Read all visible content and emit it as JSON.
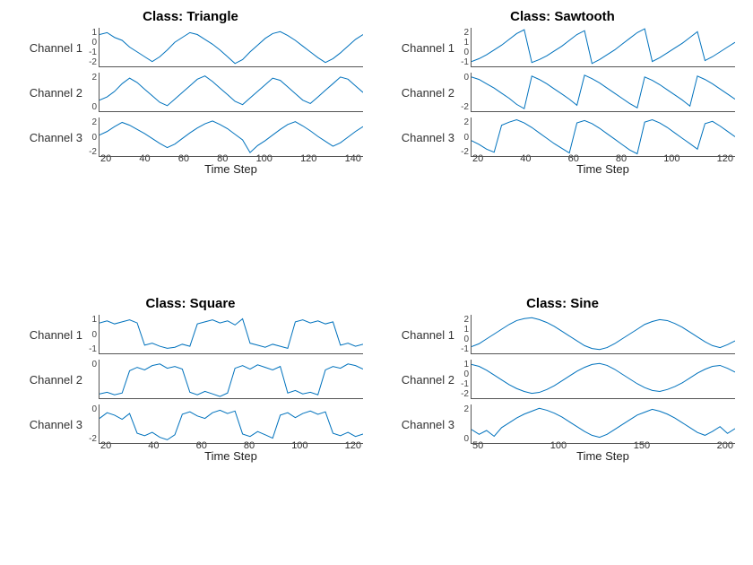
{
  "chart_data": [
    {
      "title": "Class: Triangle",
      "xlabel": "Time Step",
      "xticks": [
        "20",
        "40",
        "60",
        "80",
        "100",
        "120",
        "140"
      ],
      "xmax": 140,
      "channels": [
        {
          "label": "Channel 1",
          "yticks": [
            "1",
            "0",
            "-1",
            "-2"
          ],
          "ymin": -2.5,
          "ymax": 1.5,
          "data": [
            0.8,
            1.0,
            0.5,
            0.2,
            -0.5,
            -1.0,
            -1.5,
            -2.0,
            -1.5,
            -0.8,
            0.0,
            0.5,
            1.0,
            0.8,
            0.3,
            -0.2,
            -0.8,
            -1.5,
            -2.2,
            -1.8,
            -1.0,
            -0.3,
            0.4,
            0.9,
            1.1,
            0.7,
            0.2,
            -0.4,
            -1.0,
            -1.6,
            -2.1,
            -1.7,
            -1.1,
            -0.4,
            0.3,
            0.8
          ]
        },
        {
          "label": "Channel 2",
          "yticks": [
            "2",
            "0"
          ],
          "ymin": -1.0,
          "ymax": 2.5,
          "data": [
            0.0,
            0.3,
            0.8,
            1.5,
            2.0,
            1.6,
            1.0,
            0.4,
            -0.2,
            -0.5,
            0.1,
            0.7,
            1.3,
            1.9,
            2.2,
            1.7,
            1.1,
            0.5,
            -0.1,
            -0.4,
            0.2,
            0.8,
            1.4,
            2.0,
            1.8,
            1.2,
            0.6,
            0.0,
            -0.3,
            0.3,
            0.9,
            1.5,
            2.1,
            1.9,
            1.3,
            0.7
          ]
        },
        {
          "label": "Channel 3",
          "yticks": [
            "2",
            "0",
            "-2"
          ],
          "ymin": -3.0,
          "ymax": 2.5,
          "data": [
            0.0,
            0.5,
            1.2,
            1.8,
            1.4,
            0.8,
            0.2,
            -0.5,
            -1.2,
            -1.8,
            -1.3,
            -0.5,
            0.3,
            1.0,
            1.6,
            2.0,
            1.5,
            0.9,
            0.1,
            -0.7,
            -2.5,
            -1.5,
            -0.8,
            0.0,
            0.8,
            1.5,
            1.9,
            1.3,
            0.6,
            -0.2,
            -0.9,
            -1.6,
            -1.1,
            -0.3,
            0.5,
            1.2
          ]
        }
      ]
    },
    {
      "title": "Class: Sawtooth",
      "xlabel": "Time Step",
      "xticks": [
        "20",
        "40",
        "60",
        "80",
        "100",
        "120"
      ],
      "xmax": 125,
      "channels": [
        {
          "label": "Channel 1",
          "yticks": [
            "2",
            "1",
            "0",
            "-1"
          ],
          "ymin": -1.5,
          "ymax": 2.5,
          "data": [
            -1.0,
            -0.7,
            -0.3,
            0.2,
            0.7,
            1.3,
            1.9,
            2.3,
            -1.1,
            -0.8,
            -0.4,
            0.1,
            0.6,
            1.2,
            1.8,
            2.2,
            -1.2,
            -0.8,
            -0.3,
            0.2,
            0.8,
            1.4,
            2.0,
            2.4,
            -1.0,
            -0.6,
            -0.1,
            0.4,
            0.9,
            1.5,
            2.1,
            -0.9,
            -0.5,
            0.0,
            0.5,
            1.0
          ]
        },
        {
          "label": "Channel 2",
          "yticks": [
            "0",
            "-2"
          ],
          "ymin": -3.0,
          "ymax": 1.5,
          "data": [
            1.0,
            0.7,
            0.2,
            -0.3,
            -0.9,
            -1.5,
            -2.2,
            -2.7,
            1.1,
            0.7,
            0.2,
            -0.4,
            -1.0,
            -1.6,
            -2.3,
            1.2,
            0.8,
            0.3,
            -0.3,
            -0.9,
            -1.5,
            -2.1,
            -2.6,
            1.0,
            0.6,
            0.1,
            -0.5,
            -1.1,
            -1.7,
            -2.4,
            1.1,
            0.7,
            0.2,
            -0.4,
            -1.0,
            -1.6
          ]
        },
        {
          "label": "Channel 3",
          "yticks": [
            "2",
            "0",
            "-2"
          ],
          "ymin": -2.5,
          "ymax": 2.5,
          "data": [
            -0.5,
            -1.0,
            -1.6,
            -2.0,
            1.5,
            1.9,
            2.2,
            1.8,
            1.2,
            0.5,
            -0.2,
            -0.9,
            -1.5,
            -2.1,
            1.8,
            2.1,
            1.7,
            1.1,
            0.4,
            -0.3,
            -1.0,
            -1.7,
            -2.2,
            1.9,
            2.2,
            1.8,
            1.2,
            0.5,
            -0.2,
            -0.9,
            -1.6,
            1.7,
            2.0,
            1.4,
            0.7,
            0.0
          ]
        }
      ]
    },
    {
      "title": "Class: Square",
      "xlabel": "Time Step",
      "xticks": [
        "20",
        "40",
        "60",
        "80",
        "100",
        "120"
      ],
      "xmax": 125,
      "channels": [
        {
          "label": "Channel 1",
          "yticks": [
            "1",
            "0",
            "-1"
          ],
          "ymin": -2.0,
          "ymax": 1.8,
          "data": [
            1.0,
            1.2,
            0.9,
            1.1,
            1.3,
            1.0,
            -1.2,
            -1.0,
            -1.3,
            -1.5,
            -1.4,
            -1.1,
            -1.3,
            0.9,
            1.1,
            1.3,
            1.0,
            1.2,
            0.8,
            1.4,
            -1.0,
            -1.2,
            -1.4,
            -1.1,
            -1.3,
            -1.5,
            1.1,
            1.3,
            1.0,
            1.2,
            0.9,
            1.1,
            -1.2,
            -1.0,
            -1.3,
            -1.1
          ]
        },
        {
          "label": "Channel 2",
          "yticks": [
            "0"
          ],
          "ymin": -2.0,
          "ymax": 2.5,
          "data": [
            -1.5,
            -1.3,
            -1.6,
            -1.4,
            1.2,
            1.6,
            1.3,
            1.8,
            2.0,
            1.5,
            1.7,
            1.4,
            -1.3,
            -1.6,
            -1.2,
            -1.5,
            -1.8,
            -1.4,
            1.5,
            1.8,
            1.4,
            1.9,
            1.6,
            1.3,
            1.7,
            -1.4,
            -1.1,
            -1.5,
            -1.3,
            -1.6,
            1.3,
            1.7,
            1.5,
            2.0,
            1.8,
            1.4
          ]
        },
        {
          "label": "Channel 3",
          "yticks": [
            "0",
            "-2"
          ],
          "ymin": -3.2,
          "ymax": 1.5,
          "data": [
            -0.2,
            0.5,
            0.2,
            -0.3,
            0.4,
            -2.0,
            -2.3,
            -1.9,
            -2.5,
            -2.8,
            -2.2,
            0.3,
            0.6,
            0.1,
            -0.2,
            0.5,
            0.8,
            0.4,
            0.7,
            -2.1,
            -2.4,
            -1.8,
            -2.2,
            -2.6,
            0.2,
            0.5,
            -0.1,
            0.4,
            0.7,
            0.3,
            0.6,
            -2.0,
            -2.3,
            -1.9,
            -2.4,
            -2.1
          ]
        }
      ]
    },
    {
      "title": "Class: Sine",
      "xlabel": "Time Step",
      "xticks": [
        "50",
        "100",
        "150",
        "200"
      ],
      "xmax": 200,
      "channels": [
        {
          "label": "Channel 1",
          "yticks": [
            "2",
            "1",
            "0",
            "-1"
          ],
          "ymin": -1.5,
          "ymax": 2.5,
          "data": [
            -0.8,
            -0.5,
            0.0,
            0.5,
            1.0,
            1.5,
            1.9,
            2.1,
            2.2,
            2.0,
            1.7,
            1.3,
            0.8,
            0.3,
            -0.2,
            -0.7,
            -1.0,
            -1.1,
            -0.9,
            -0.5,
            0.0,
            0.5,
            1.0,
            1.5,
            1.8,
            2.0,
            1.9,
            1.6,
            1.2,
            0.7,
            0.2,
            -0.3,
            -0.7,
            -0.9,
            -0.6,
            -0.2
          ]
        },
        {
          "label": "Channel 2",
          "yticks": [
            "1",
            "0",
            "-1",
            "-2"
          ],
          "ymin": -2.5,
          "ymax": 1.5,
          "data": [
            1.0,
            0.8,
            0.4,
            -0.1,
            -0.6,
            -1.1,
            -1.5,
            -1.8,
            -2.0,
            -1.9,
            -1.6,
            -1.2,
            -0.7,
            -0.2,
            0.3,
            0.7,
            1.0,
            1.1,
            0.9,
            0.5,
            0.0,
            -0.5,
            -1.0,
            -1.4,
            -1.7,
            -1.8,
            -1.6,
            -1.3,
            -0.9,
            -0.4,
            0.1,
            0.5,
            0.8,
            0.9,
            0.6,
            0.2
          ]
        },
        {
          "label": "Channel 3",
          "yticks": [
            "2",
            "0"
          ],
          "ymin": -1.2,
          "ymax": 2.8,
          "data": [
            0.2,
            -0.3,
            0.1,
            -0.5,
            0.4,
            0.9,
            1.4,
            1.8,
            2.1,
            2.4,
            2.2,
            1.9,
            1.5,
            1.0,
            0.5,
            0.0,
            -0.4,
            -0.6,
            -0.3,
            0.2,
            0.7,
            1.2,
            1.7,
            2.0,
            2.3,
            2.1,
            1.8,
            1.4,
            0.9,
            0.4,
            -0.1,
            -0.4,
            0.0,
            0.5,
            -0.2,
            0.3
          ]
        }
      ]
    }
  ],
  "line_color": "#0072BD"
}
